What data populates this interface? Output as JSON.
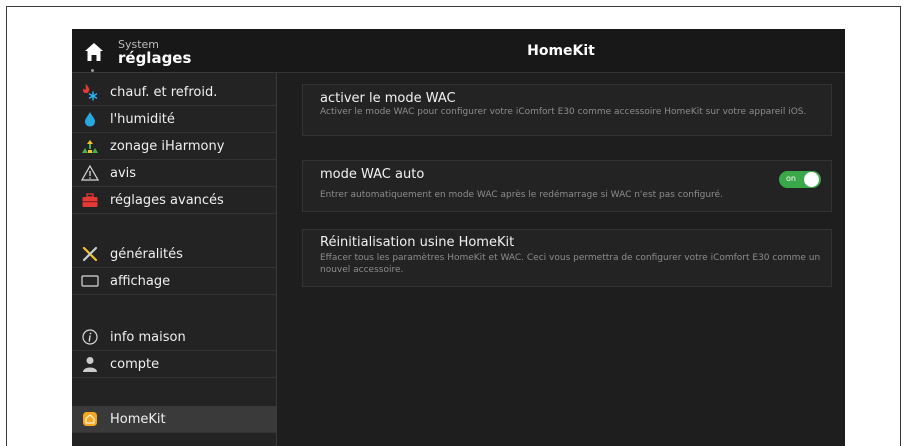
{
  "sidebar": {
    "header": {
      "small": "System",
      "big": "réglages"
    },
    "items": [
      {
        "label": "chauf. et refroid.",
        "icon": "heat-cool-icon"
      },
      {
        "label": "l'humidité",
        "icon": "humidity-drop-icon"
      },
      {
        "label": "zonage iHarmony",
        "icon": "zoning-icon"
      },
      {
        "label": "avis",
        "icon": "warning-icon"
      },
      {
        "label": "réglages avancés",
        "icon": "toolbox-icon"
      },
      {
        "label": "généralités",
        "icon": "tools-icon"
      },
      {
        "label": "affichage",
        "icon": "display-icon"
      },
      {
        "label": "info maison",
        "icon": "info-icon"
      },
      {
        "label": "compte",
        "icon": "user-icon"
      },
      {
        "label": "HomeKit",
        "icon": "homekit-icon"
      }
    ]
  },
  "main": {
    "title": "HomeKit",
    "cards": [
      {
        "title": "activer le mode WAC",
        "desc": "Activer le mode WAC pour configurer votre iComfort E30 comme accessoire HomeKit sur votre appareil iOS."
      },
      {
        "title": "mode WAC auto",
        "desc": "Entrer automatiquement en mode WAC après le redémarrage si WAC n'est pas configuré.",
        "toggle": "on"
      },
      {
        "title": "Réinitialisation usine HomeKit",
        "desc": "Effacer tous les paramètres HomeKit et WAC. Ceci vous permettra de configurer votre iComfort E30 comme un nouvel accessoire."
      }
    ]
  },
  "colors": {
    "background": "#1e1e1e",
    "sidebar": "#232323",
    "header": "#181818",
    "active_item": "#3a3a3a",
    "toggle_on": "#3aa84a"
  }
}
